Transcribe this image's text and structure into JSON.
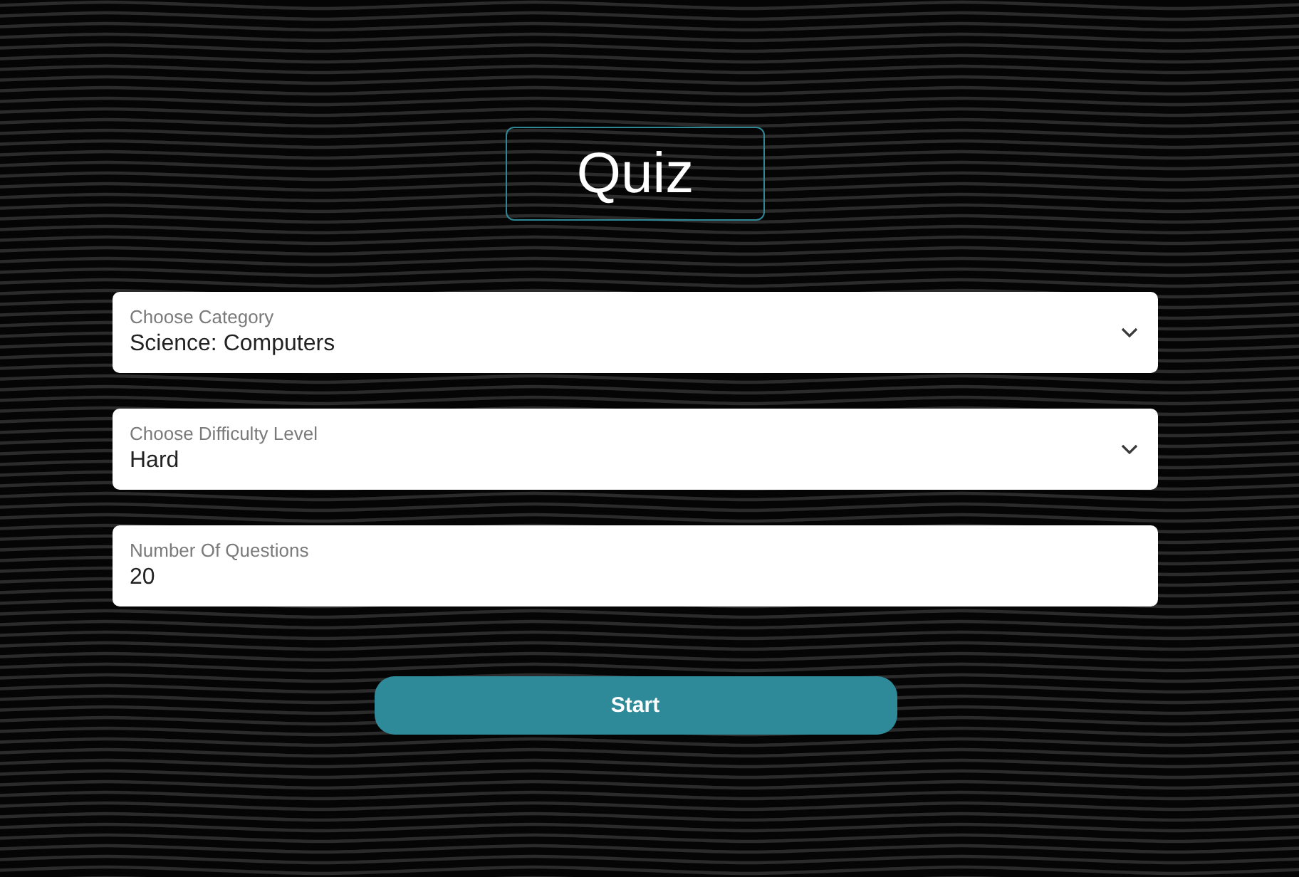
{
  "title": "Quiz",
  "fields": [
    {
      "kind": "select",
      "label": "Choose Category",
      "value": "Science: Computers"
    },
    {
      "kind": "select",
      "label": "Choose Difficulty Level",
      "value": "Hard"
    },
    {
      "kind": "number",
      "label": "Number Of Questions",
      "value": "20"
    }
  ],
  "start_button": {
    "label": "Start"
  }
}
